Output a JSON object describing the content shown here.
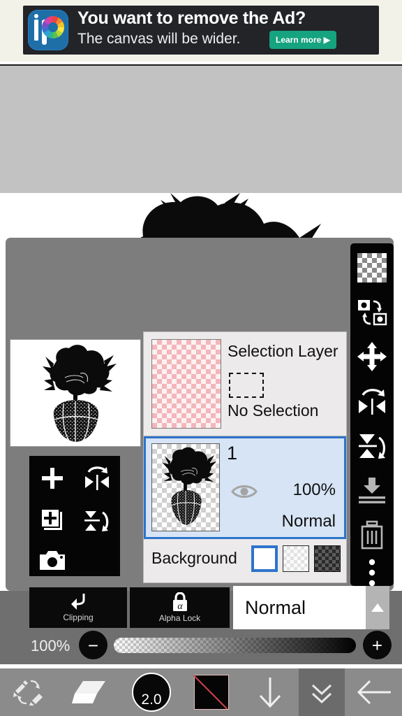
{
  "app": {
    "name": "ibisPaint X",
    "screen": "layer-panel"
  },
  "ad": {
    "headline": "You want to remove the Ad?",
    "subline": "The canvas will be wider.",
    "cta_label": "Learn more ▶",
    "logo_text_i": "i",
    "logo_text_p": "P",
    "bg_color": "#222428",
    "cta_color": "#16a37f",
    "logo_color": "#1e6ea8"
  },
  "canvas": {
    "background_color": "#ffffff",
    "top_strip_color": "#c2c2c2",
    "artwork_description": "black silhouette character with spiky hair and grainy textured body"
  },
  "quick_tools": {
    "items": [
      {
        "name": "add-layer",
        "icon": "plus-icon",
        "label": "Add Layer"
      },
      {
        "name": "flip-horizontal",
        "icon": "flip-horizontal-icon",
        "label": "Flip Horizontal"
      },
      {
        "name": "duplicate-layer",
        "icon": "duplicate-layer-icon",
        "label": "Duplicate Layer"
      },
      {
        "name": "flip-vertical",
        "icon": "flip-vertical-icon",
        "label": "Flip Vertical"
      },
      {
        "name": "camera",
        "icon": "camera-icon",
        "label": "Camera"
      }
    ]
  },
  "layers": {
    "selection_layer": {
      "title": "Selection Layer",
      "status": "No Selection",
      "thumbnail": "pink-checkerboard",
      "marquee_icon": "dashed-rectangle-icon"
    },
    "layer_one": {
      "name": "1",
      "opacity": "100%",
      "blend_mode": "Normal",
      "visible": true,
      "selected": true,
      "thumbnail": "character-silhouette-transparent"
    },
    "background": {
      "label": "Background",
      "swatches": [
        {
          "name": "white",
          "selected": true
        },
        {
          "name": "light-checker",
          "selected": false
        },
        {
          "name": "dark-checker",
          "selected": false
        }
      ]
    },
    "selected_highlight_color": "#2e74cb",
    "selected_row_bg": "#d6e4f5"
  },
  "right_toolbar": {
    "items": [
      {
        "name": "transparency-checker",
        "icon": "checkerboard-icon",
        "label": "Transparency"
      },
      {
        "name": "swap-layers",
        "icon": "swap-layers-icon",
        "label": "Swap Layers"
      },
      {
        "name": "move-layer",
        "icon": "move-arrows-icon",
        "label": "Move"
      },
      {
        "name": "rotate-flip-horizontal",
        "icon": "rotate-flip-horizontal-icon",
        "label": "Flip Horizontal"
      },
      {
        "name": "rotate-flip-vertical",
        "icon": "rotate-flip-vertical-icon",
        "label": "Flip Vertical"
      },
      {
        "name": "merge-down",
        "icon": "merge-down-icon",
        "label": "Merge Down"
      },
      {
        "name": "delete-layer",
        "icon": "trash-icon",
        "label": "Delete"
      },
      {
        "name": "more-options",
        "icon": "more-vertical-icon",
        "label": "More"
      }
    ]
  },
  "layer_controls": {
    "clipping_label": "Clipping",
    "clipping_icon": "clipping-arrow-icon",
    "alpha_lock_label": "Alpha Lock",
    "alpha_lock_icon": "alpha-lock-icon",
    "blend_mode_value": "Normal",
    "blend_mode_arrow": "triangle-up-icon",
    "opacity_value": "100%",
    "opacity_percent": 100,
    "minus_label": "−",
    "plus_label": "+"
  },
  "bottom_toolbar": {
    "items": [
      {
        "name": "brush-eraser-swap",
        "icon": "brush-eraser-swap-icon",
        "label": "Swap Brush/Eraser",
        "active": false
      },
      {
        "name": "eraser-tool",
        "icon": "eraser-icon",
        "label": "Eraser",
        "active": false
      },
      {
        "name": "brush-size",
        "icon": "brush-size-icon",
        "label": "Brush Size",
        "value": "2.0",
        "active": false
      },
      {
        "name": "color-swatch",
        "icon": "color-swatch-icon",
        "label": "Color",
        "active": false
      },
      {
        "name": "download",
        "icon": "arrow-down-icon",
        "label": "Download",
        "active": false
      },
      {
        "name": "collapse-panel",
        "icon": "double-chevron-down-icon",
        "label": "Collapse",
        "active": true
      },
      {
        "name": "back",
        "icon": "arrow-left-icon",
        "label": "Back",
        "active": false
      }
    ],
    "bg_color": "#8b8b8b",
    "active_color": "#6b6b6b"
  }
}
